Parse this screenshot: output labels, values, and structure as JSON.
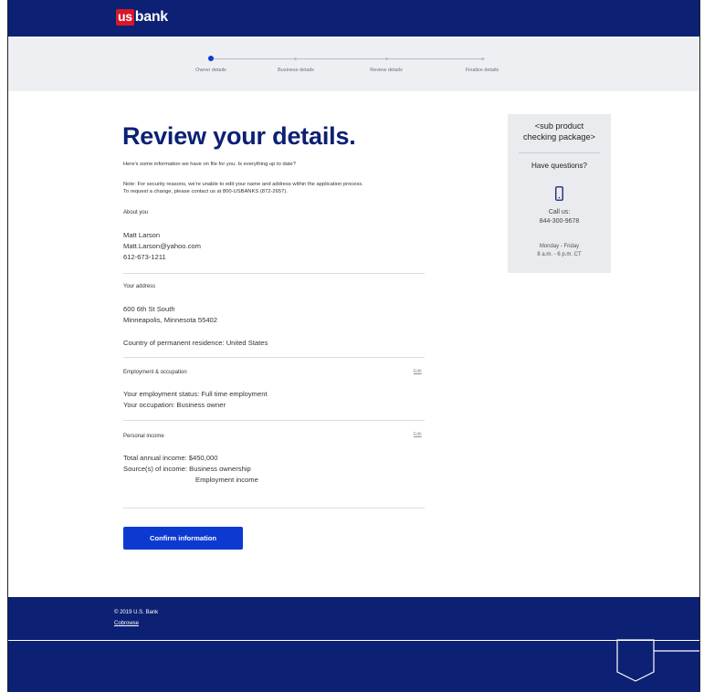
{
  "header": {
    "logo_us": "us",
    "logo_bank": "bank"
  },
  "progress": {
    "steps": [
      {
        "label": "Owner details",
        "active": true
      },
      {
        "label": "Business details",
        "active": false
      },
      {
        "label": "Review details",
        "active": false
      },
      {
        "label": "Finalize details",
        "active": false
      }
    ]
  },
  "main": {
    "title": "Review your details.",
    "intro": "Here's some information we have on file for you. Is everything up to date?",
    "note_line1": "Note: For security reasons, we're unable to edit your name and address within the application process.",
    "note_line2": "To request a change, please contact us at 800-USBANKS (872-2657).",
    "about": {
      "heading": "About you",
      "name": "Matt Larson",
      "email": "Matt.Larson@yahoo.com",
      "phone": "612-673-1211"
    },
    "address": {
      "heading": "Your address",
      "line1": "600 6th St South",
      "line2": "Minneapolis, Minnesota 55402",
      "country": "Country of permanent residence: United States"
    },
    "employment": {
      "heading": "Employment & occupation",
      "edit": "Edit",
      "status": "Your employment status: Full time employment",
      "occupation": "Your occupation: Business owner"
    },
    "income": {
      "heading": "Personal income",
      "edit": "Edit",
      "total": "Total annual income: $450,000",
      "sources_label": "Source(s) of income: Business ownership",
      "sources_extra": "Employment income"
    },
    "confirm_button": "Confirm information"
  },
  "sidebar": {
    "product_line1": "<sub product",
    "product_line2": "checking package>",
    "questions": "Have questions?",
    "phone_icon": "phone-icon",
    "call_label": "Call us:",
    "call_number": "844-300-9678",
    "hours_days": "Monday - Friday",
    "hours_time": "8 a.m. - 6 p.m. CT"
  },
  "footer": {
    "copyright": "© 2019 U.S. Bank",
    "cobrowse": "Cobrowse"
  },
  "colors": {
    "brand_navy": "#0c2074",
    "brand_red": "#d8172a",
    "accent_blue": "#0c3ad1",
    "progress_bg": "#eeeff2",
    "card_bg": "#eaebef"
  }
}
